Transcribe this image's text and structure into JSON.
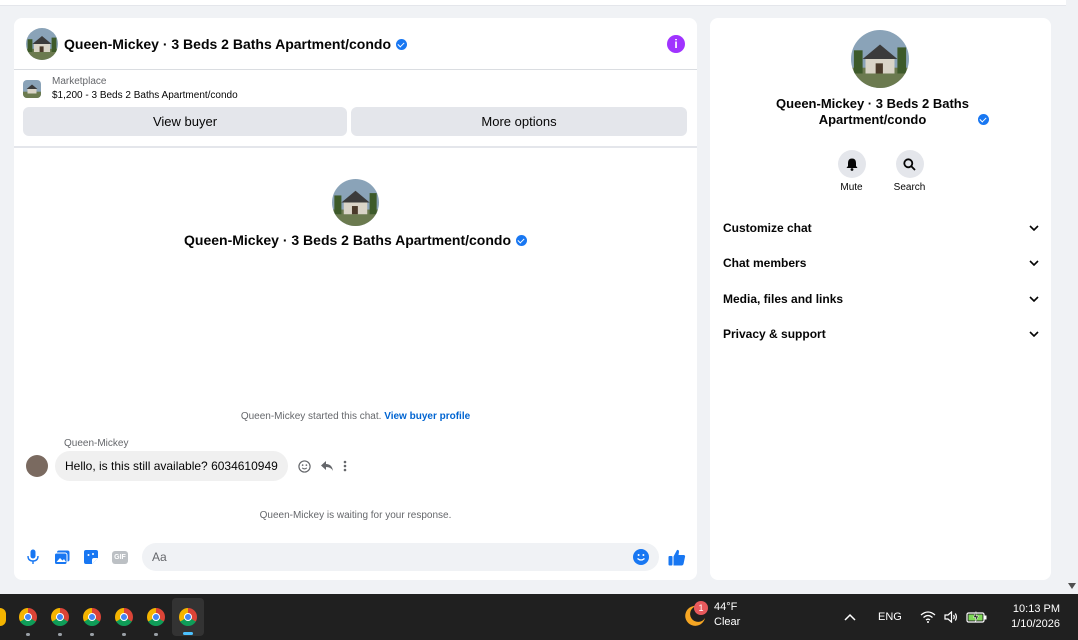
{
  "conversation": {
    "title": "Queen-Mickey · 3 Beds 2 Baths Apartment/condo",
    "info_icon": "info-icon"
  },
  "marketplace": {
    "label": "Marketplace",
    "listing": "$1,200 - 3 Beds 2 Baths Apartment/condo",
    "view_buyer": "View buyer",
    "more_options": "More options"
  },
  "thread": {
    "intro_title": "Queen-Mickey · 3 Beds 2 Baths Apartment/condo",
    "started_text": "Queen-Mickey started this chat.",
    "buyer_profile_link": "View buyer profile",
    "sender_name": "Queen-Mickey",
    "message": "Hello, is this still available? 6034610949",
    "waiting_text": "Queen-Mickey is waiting for your response."
  },
  "composer": {
    "placeholder": "Aa",
    "gif_label": "GIF"
  },
  "sidebar": {
    "title": "Queen-Mickey · 3 Beds 2 Baths Apartment/condo",
    "actions": [
      {
        "label": "Mute",
        "icon": "bell-icon"
      },
      {
        "label": "Search",
        "icon": "search-icon"
      }
    ],
    "menu": [
      {
        "label": "Customize chat"
      },
      {
        "label": "Chat members"
      },
      {
        "label": "Media, files and links"
      },
      {
        "label": "Privacy & support"
      }
    ]
  },
  "taskbar": {
    "weather_temp": "44°F",
    "weather_desc": "Clear",
    "notification_count": "1",
    "language": "ENG",
    "time": "10:13 PM",
    "date": "1/10/2026"
  },
  "colors": {
    "accent": "#1877f2",
    "info": "#a033ff",
    "taskbar": "#202020"
  }
}
